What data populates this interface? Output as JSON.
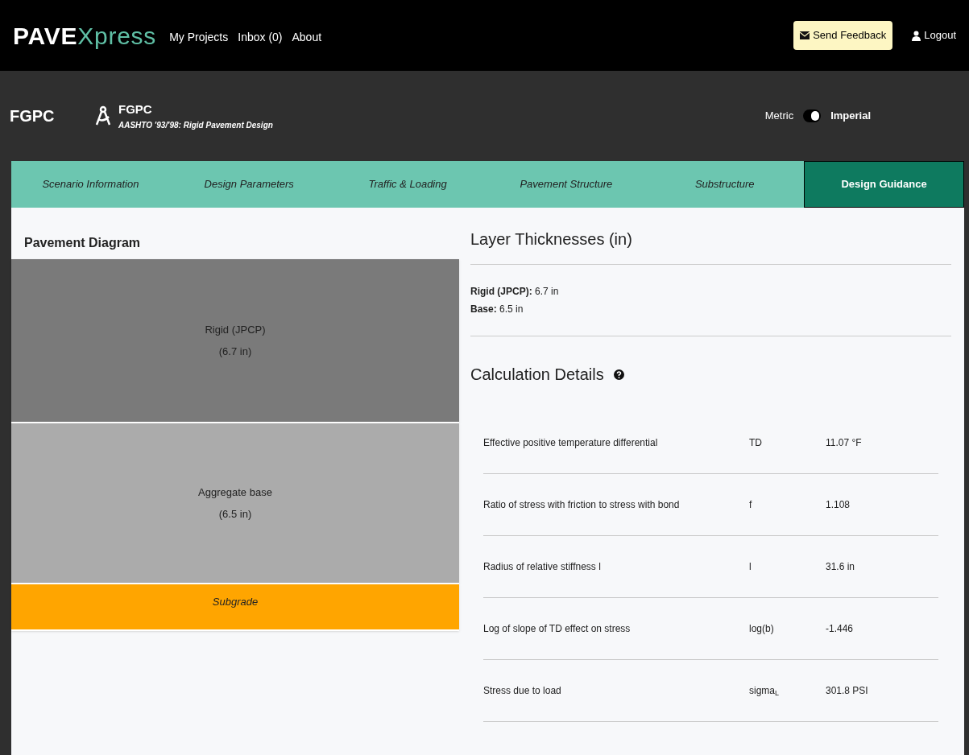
{
  "nav": {
    "logo_bold": "PAVE",
    "logo_light": "Xpress",
    "links": [
      "My Projects",
      "Inbox (0)",
      "About"
    ],
    "feedback_button": "Send Feedback",
    "logout": "Logout"
  },
  "header": {
    "project_short": "FGPC",
    "project_name": "FGPC",
    "design_type": "AASHTO '93/'98: Rigid Pavement Design",
    "unit_toggle": {
      "left_label": "Metric",
      "right_label": "Imperial",
      "imperial": true
    }
  },
  "tabs": [
    {
      "label": "Scenario Information",
      "selected": false
    },
    {
      "label": "Design Parameters",
      "selected": false
    },
    {
      "label": "Traffic & Loading",
      "selected": false
    },
    {
      "label": "Pavement Structure",
      "selected": false
    },
    {
      "label": "Substructure",
      "selected": false
    },
    {
      "label": "Design Guidance",
      "selected": true
    }
  ],
  "diagram": {
    "title": "Pavement Diagram",
    "layers": [
      {
        "name": "Rigid (JPCP)",
        "thickness": "(6.7 in)",
        "color": "#7a7a7a",
        "kind": "layer"
      },
      {
        "name": "Aggregate base",
        "thickness": "(6.5 in)",
        "color": "#ababab",
        "kind": "layer"
      },
      {
        "name": "Subgrade",
        "color": "#ffa500",
        "kind": "subgrade"
      }
    ]
  },
  "thicknesses": {
    "title": "Layer Thicknesses (in)",
    "lines": [
      "**Rigid (JPCP):** 6.7 in",
      "**Base:** 6.5 in"
    ]
  },
  "calculation": {
    "title": "Calculation Details",
    "rows": [
      {
        "description": "Effective positive temperature differential",
        "symbol": "TD",
        "value": "11.07 °F"
      },
      {
        "description": "Ratio of stress with friction to stress with bond",
        "symbol": "f",
        "value": "1.108"
      },
      {
        "description": "Radius of relative stiffness l",
        "symbol": "l",
        "value": "31.6 in"
      },
      {
        "description": "Log of slope of TD effect on stress",
        "symbol": "log(b)",
        "value": "-1.446"
      },
      {
        "description": "Stress due to load",
        "symbol": "sigma$_{L}$",
        "value": "301.8 PSI"
      }
    ]
  }
}
